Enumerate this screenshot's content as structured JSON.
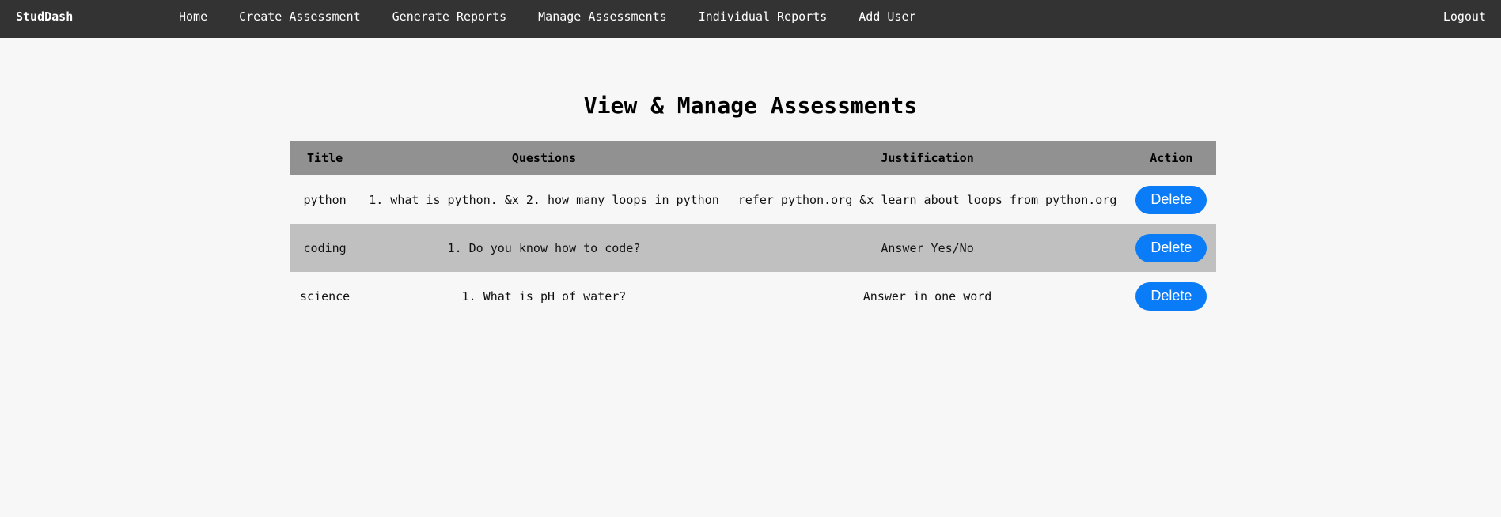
{
  "nav": {
    "brand": "StudDash",
    "links": [
      {
        "label": "Home"
      },
      {
        "label": "Create Assessment"
      },
      {
        "label": "Generate Reports"
      },
      {
        "label": "Manage Assessments"
      },
      {
        "label": "Individual Reports"
      },
      {
        "label": "Add User"
      }
    ],
    "logout": "Logout"
  },
  "page": {
    "title": "View & Manage Assessments"
  },
  "table": {
    "headers": {
      "title": "Title",
      "questions": "Questions",
      "justification": "Justification",
      "action": "Action"
    },
    "rows": [
      {
        "title": "python",
        "questions": "1. what is python. &x 2. how many loops in python",
        "justification": "refer python.org &x learn about loops from python.org",
        "action": "Delete"
      },
      {
        "title": "coding",
        "questions": "1. Do you know how to code?",
        "justification": "Answer Yes/No",
        "action": "Delete"
      },
      {
        "title": "science",
        "questions": "1. What is pH of water?",
        "justification": "Answer in one word",
        "action": "Delete"
      }
    ]
  },
  "colors": {
    "navbar": "#333333",
    "background": "#f7f7f7",
    "header_row": "#919191",
    "alt_row": "#c0c0c0",
    "button": "#0a7cf7"
  }
}
